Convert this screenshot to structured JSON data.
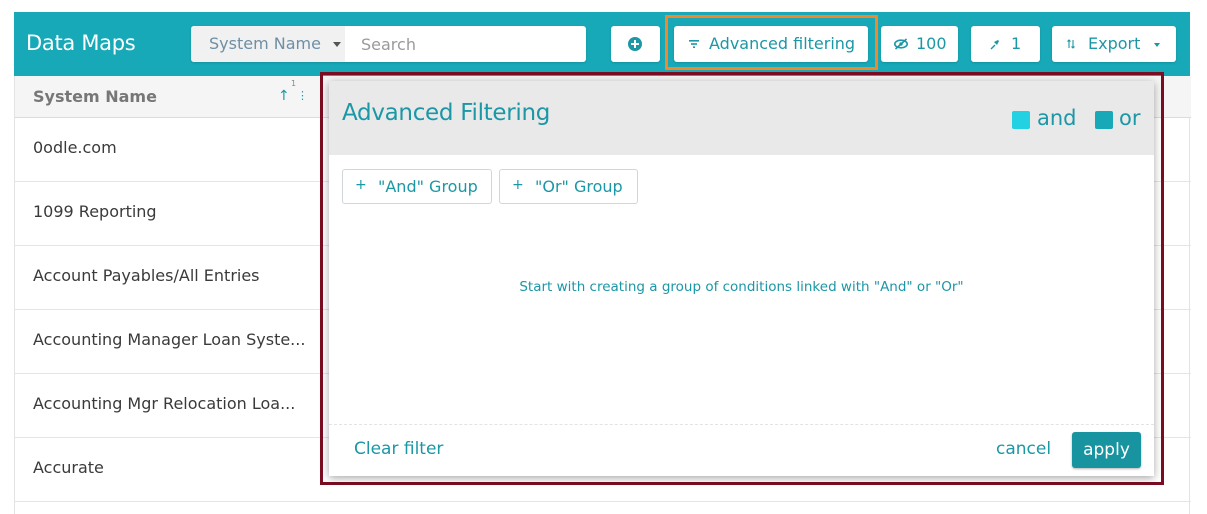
{
  "header": {
    "title": "Data Maps",
    "field_select": "System Name",
    "search_placeholder": "Search",
    "advanced_label": "Advanced filtering",
    "hidden_count": "100",
    "pinned_count": "1",
    "export_label": "Export"
  },
  "grid": {
    "column_header": "System Name",
    "sort_order": "1",
    "rows": [
      "0odle.com",
      "1099 Reporting",
      "Account Payables/All Entries",
      "Accounting Manager Loan Syste...",
      "Accounting Mgr Relocation Loa...",
      "Accurate"
    ]
  },
  "dialog": {
    "title": "Advanced Filtering",
    "legend": {
      "and": "and",
      "or": "or"
    },
    "and_group_label": "\"And\" Group",
    "or_group_label": "\"Or\" Group",
    "empty_message": "Start with creating a group of conditions linked with \"And\" or \"Or\"",
    "clear_label": "Clear filter",
    "cancel_label": "cancel",
    "apply_label": "apply"
  },
  "colors": {
    "accent": "#17a9b8",
    "and_swatch": "#22d1e2",
    "or_swatch": "#17a9b8",
    "highlight_orange": "#f2882a",
    "highlight_dark_red": "#7a0d22"
  },
  "icons": {
    "add": "plus-circle-icon",
    "advanced": "filter-icon",
    "hide": "eye-slash-icon",
    "pin": "pin-icon",
    "export": "sort-arrows-icon",
    "sort": "arrow-up-icon"
  }
}
